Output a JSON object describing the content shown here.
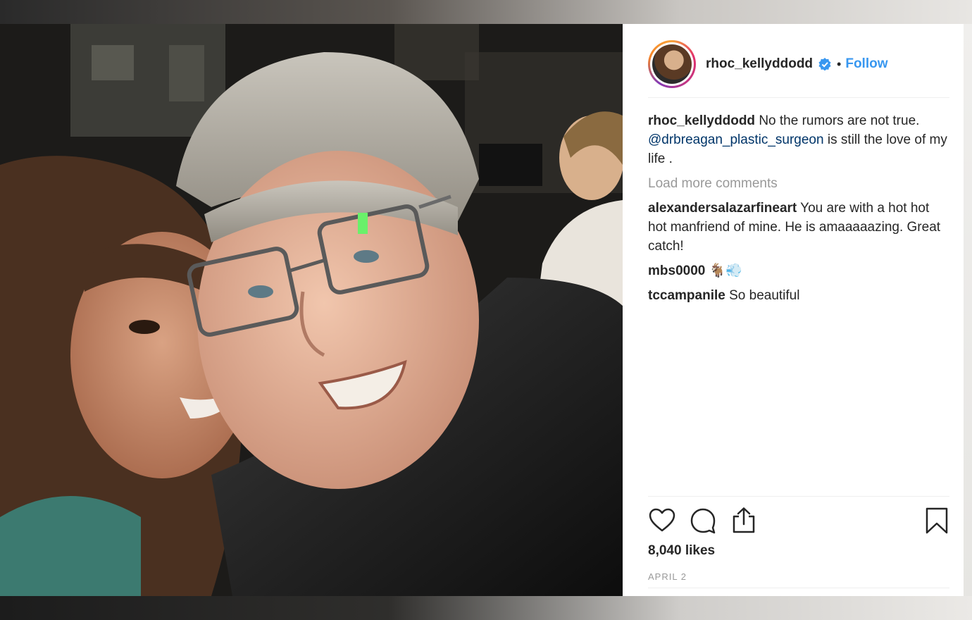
{
  "post": {
    "username": "rhoc_kellyddodd",
    "dot": "•",
    "follow_label": "Follow",
    "caption": {
      "username": "rhoc_kellyddodd",
      "text_before": "No the rumors are not true.",
      "mention": "@drbreagan_plastic_surgeon",
      "text_after": "is still the love of my life ."
    },
    "load_more_label": "Load more comments",
    "comments": [
      {
        "username": "alexandersalazarfineart",
        "text": "You are with a hot hot hot manfriend of mine. He is amaaaaazing. Great catch!"
      },
      {
        "username": "mbs0000",
        "text": "🐐💨"
      },
      {
        "username": "tccampanile",
        "text": "So beautiful"
      }
    ],
    "likes": "8,040 likes",
    "date": "APRIL 2"
  },
  "icons": [
    "heart-icon",
    "comment-icon",
    "share-icon",
    "bookmark-icon",
    "verified-icon"
  ],
  "colors": {
    "follow": "#3897f0",
    "mention": "#003569",
    "muted": "#999999",
    "text": "#262626"
  }
}
